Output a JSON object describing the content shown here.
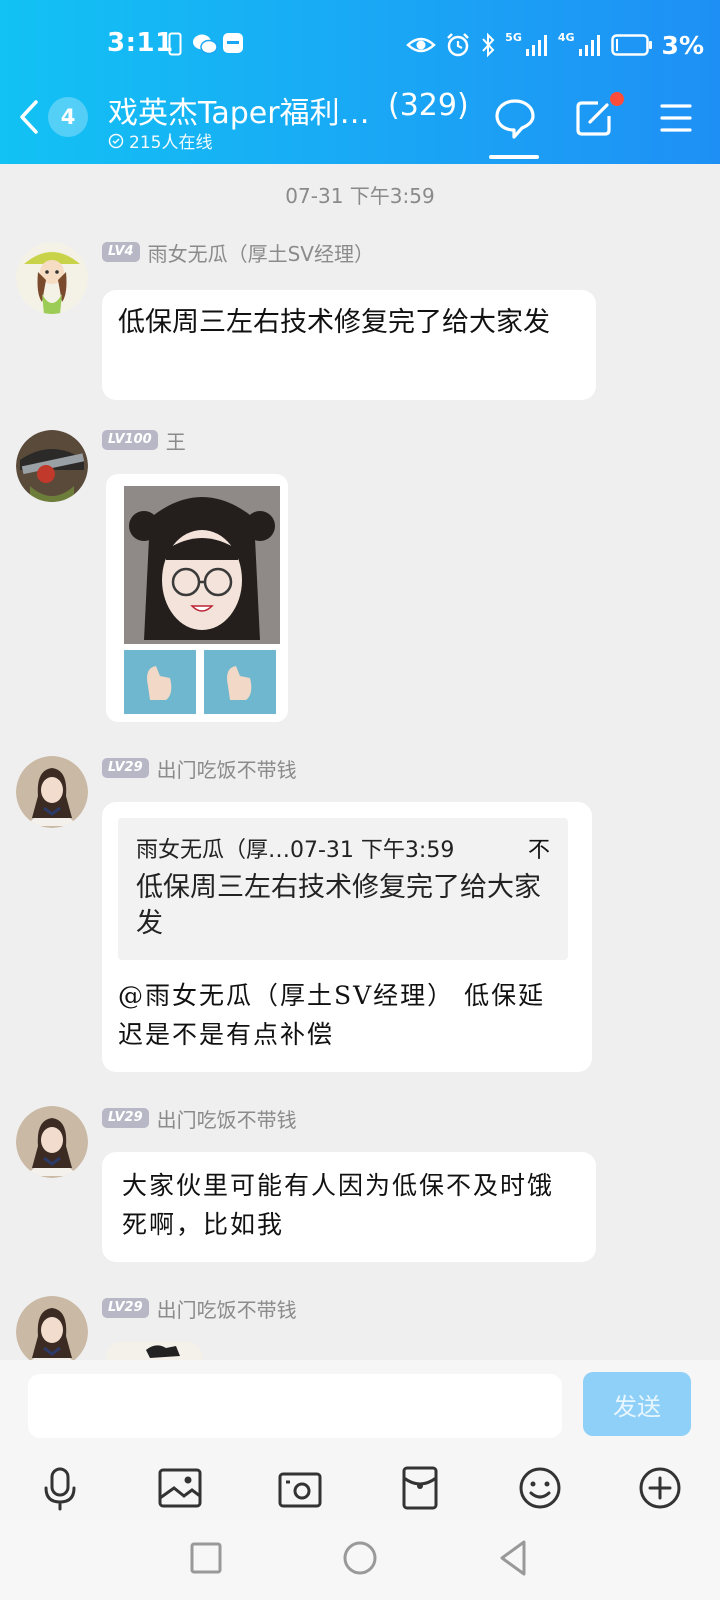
{
  "status_bar": {
    "time": "3:11",
    "battery": "3%",
    "net1": "5G",
    "net2": "4G"
  },
  "header": {
    "unread": "4",
    "group_name": "戏英杰Taper福利…",
    "member_count": "(329)",
    "online": "215人在线"
  },
  "chat": {
    "timestamp": "07-31 下午3:59",
    "messages": [
      {
        "level": "LV4",
        "sender": "雨女无瓜（厚土SV经理）",
        "text": "低保周三左右技术修复完了给大家发"
      },
      {
        "level": "LV100",
        "sender": "王"
      },
      {
        "level": "LV29",
        "sender": "出门吃饭不带钱",
        "quote": {
          "author": "雨女无瓜（厚…07-31 下午3:59",
          "jump": "不",
          "text": "低保周三左右技术修复完了给大家发"
        },
        "text": "@雨女无瓜（厚土SV经理） 低保延迟是不是有点补偿"
      },
      {
        "level": "LV29",
        "sender": "出门吃饭不带钱",
        "text": "大家伙里可能有人因为低保不及时饿死啊，比如我"
      },
      {
        "level": "LV29",
        "sender": "出门吃饭不带钱"
      }
    ]
  },
  "input": {
    "placeholder": "",
    "send_label": "发送"
  },
  "colors": {
    "header_start": "#12c2f4",
    "header_end": "#1e90f5",
    "send_disabled": "#8fd0f8",
    "notif_dot": "#ff4d3a"
  }
}
